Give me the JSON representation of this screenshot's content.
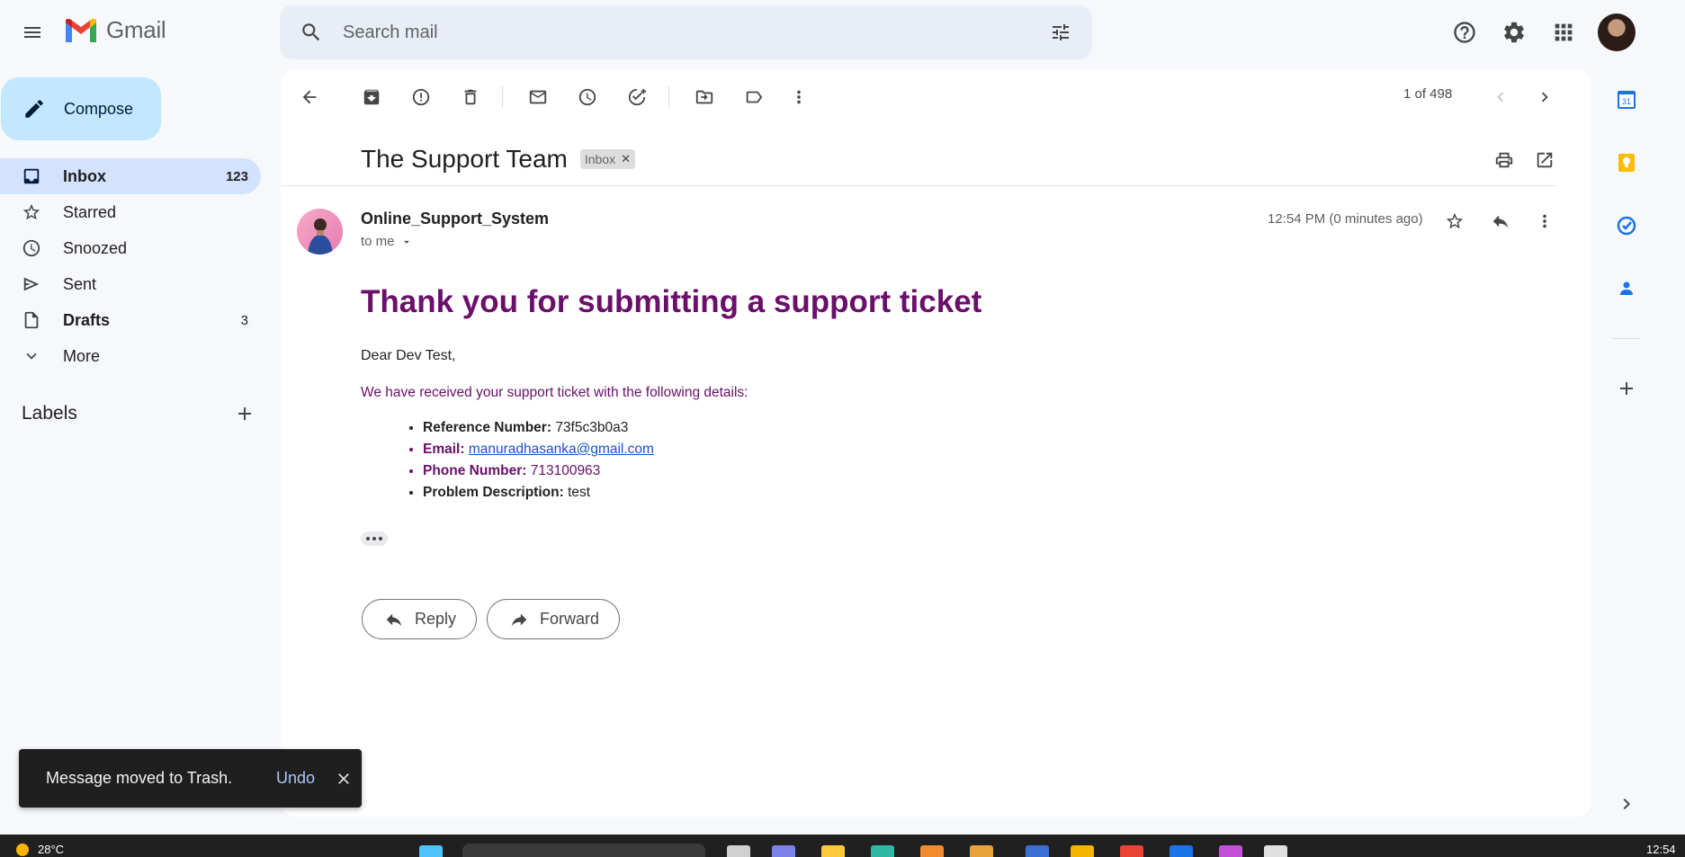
{
  "header": {
    "app_name": "Gmail",
    "search_placeholder": "Search mail"
  },
  "sidebar": {
    "compose_label": "Compose",
    "items": [
      {
        "label": "Inbox",
        "count": "123"
      },
      {
        "label": "Starred",
        "count": ""
      },
      {
        "label": "Snoozed",
        "count": ""
      },
      {
        "label": "Sent",
        "count": ""
      },
      {
        "label": "Drafts",
        "count": "3"
      },
      {
        "label": "More",
        "count": ""
      }
    ],
    "labels_heading": "Labels"
  },
  "toolbar": {
    "pager": "1 of 498"
  },
  "email": {
    "subject": "The Support Team",
    "label_chip": "Inbox",
    "sender": "Online_Support_System",
    "to": "to me",
    "time": "12:54 PM (0 minutes ago)",
    "heading": "Thank you for submitting a support ticket",
    "greeting": "Dear Dev Test,",
    "intro": "We have received your support ticket with the following details:",
    "details": [
      {
        "key": "Reference Number:",
        "value": "73f5c3b0a3"
      },
      {
        "key": "Email:",
        "value": "manuradhasanka@gmail.com"
      },
      {
        "key": "Phone Number:",
        "value": "713100963"
      },
      {
        "key": "Problem Description:",
        "value": "test"
      }
    ],
    "reply_label": "Reply",
    "forward_label": "Forward"
  },
  "snackbar": {
    "message": "Message moved to Trash.",
    "undo": "Undo"
  },
  "taskbar": {
    "weather": "28°C",
    "clock": "12:54"
  },
  "colors": {
    "accent": "#c2e7ff",
    "active_nav": "#d3e3fd",
    "heading_purple": "#6a0f6a",
    "link_blue": "#1155cc"
  }
}
